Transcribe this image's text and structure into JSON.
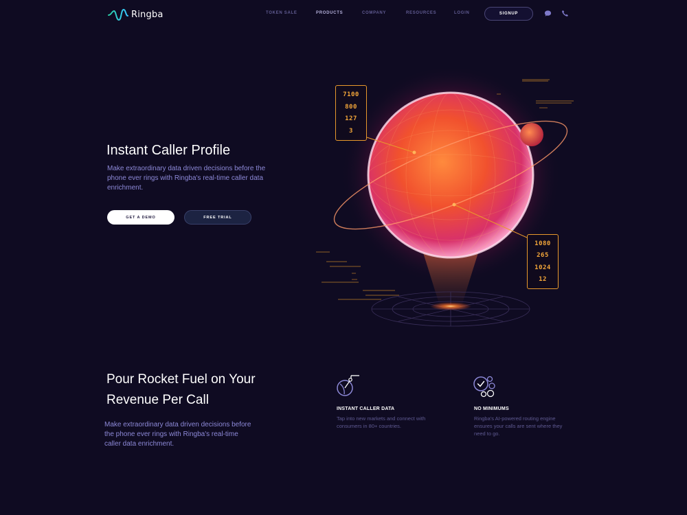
{
  "brand": {
    "name": "Ringba"
  },
  "nav": {
    "items": [
      {
        "label": "TOKEN SALE"
      },
      {
        "label": "PRODUCTS"
      },
      {
        "label": "COMPANY"
      },
      {
        "label": "RESOURCES"
      },
      {
        "label": "LOGIN"
      }
    ],
    "signup_label": "SIGNUP",
    "icons": [
      "chat-icon",
      "phone-icon"
    ]
  },
  "hero": {
    "title": "Instant Caller Profile",
    "description": "Make extraordinary data driven decisions before the phone ever rings with Ringba's real-time caller data enrichment.",
    "demo_label": "GET A DEMO",
    "trial_label": "FREE TRIAL",
    "readout_left": [
      "7100",
      "800",
      "127",
      "3"
    ],
    "readout_right": [
      "1080",
      "265",
      "1024",
      "12"
    ]
  },
  "section": {
    "title": "Pour Rocket Fuel on Your Revenue Per Call",
    "description": "Make extraordinary data driven decisions before the phone ever rings with Ringba's real-time caller data enrichment."
  },
  "features": [
    {
      "icon": "satellite-dish-icon",
      "title": "INSTANT CALLER DATA",
      "description": "Tap into new markets and connect with consumers in 80+ countries."
    },
    {
      "icon": "check-circles-icon",
      "title": "NO MINIMUMS",
      "description": "Ringba's AI-powered routing engine ensures your calls are sent where they need to go."
    }
  ],
  "colors": {
    "background": "#0f0b22",
    "accent_text": "#8d89d8",
    "readout_orange": "#f3a63a",
    "planet_core": "#ff5a2a"
  }
}
